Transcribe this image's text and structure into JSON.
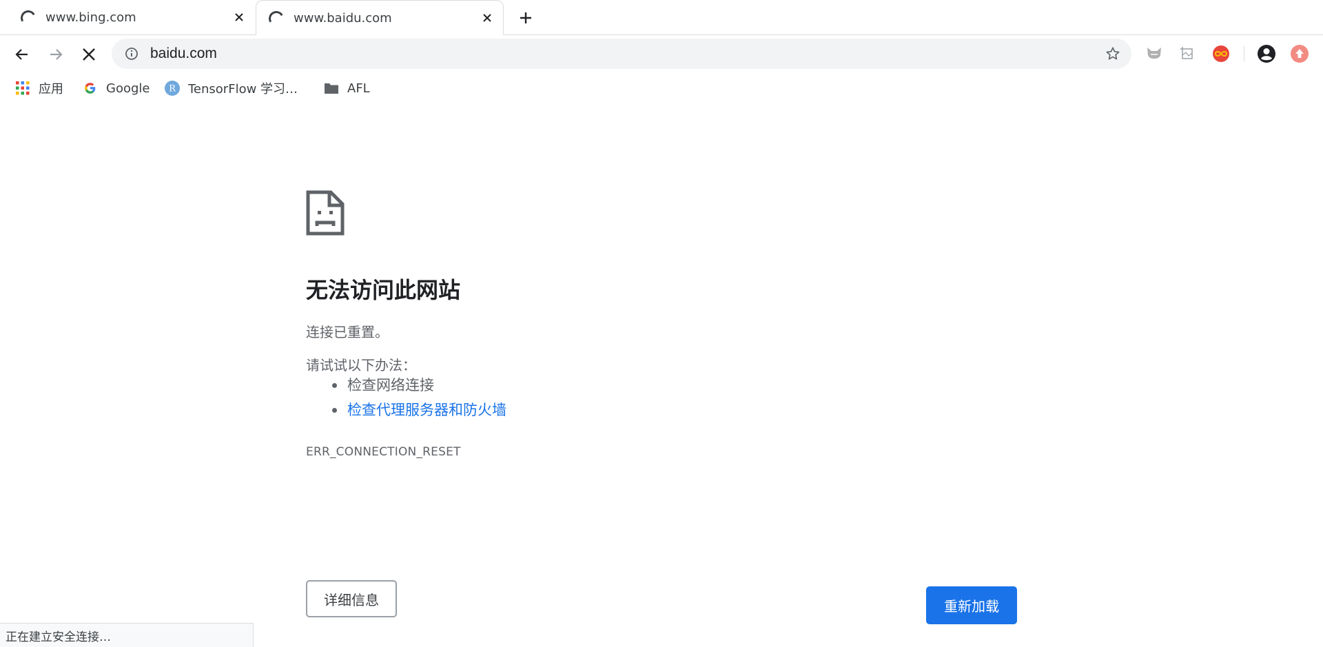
{
  "tabs": [
    {
      "title": "www.bing.com",
      "state": "loading"
    },
    {
      "title": "www.baidu.com",
      "state": "loading",
      "active": true
    }
  ],
  "toolbar": {
    "url": "baidu.com",
    "icons": [
      "back-icon",
      "forward-icon",
      "stop-icon",
      "info-icon",
      "star-icon"
    ],
    "extensions": [
      "cat-extension-icon",
      "crop-extension-icon",
      "infinity-extension-icon",
      "profile-icon",
      "update-icon"
    ]
  },
  "bookmarks": [
    {
      "label": "应用",
      "icon": "apps-grid-icon"
    },
    {
      "label": "Google",
      "icon": "google-g-icon"
    },
    {
      "label": "TensorFlow 学习…",
      "icon": "r-circle-icon",
      "icon_letter": "R"
    },
    {
      "label": "AFL",
      "icon": "folder-icon"
    }
  ],
  "error": {
    "icon": "sad-page-icon",
    "heading": "无法访问此网站",
    "message": "连接已重置。",
    "suggest_intro": "请试试以下办法：",
    "suggestions": [
      {
        "text": "检查网络连接",
        "link": false
      },
      {
        "text": "检查代理服务器和防火墙",
        "link": true
      }
    ],
    "code": "ERR_CONNECTION_RESET",
    "details_button": "详细信息",
    "reload_button": "重新加载"
  },
  "status_bar": "正在建立安全连接…",
  "colors": {
    "link": "#1a73e8",
    "primary_button": "#1a73e8",
    "text_secondary": "#5f6368"
  }
}
